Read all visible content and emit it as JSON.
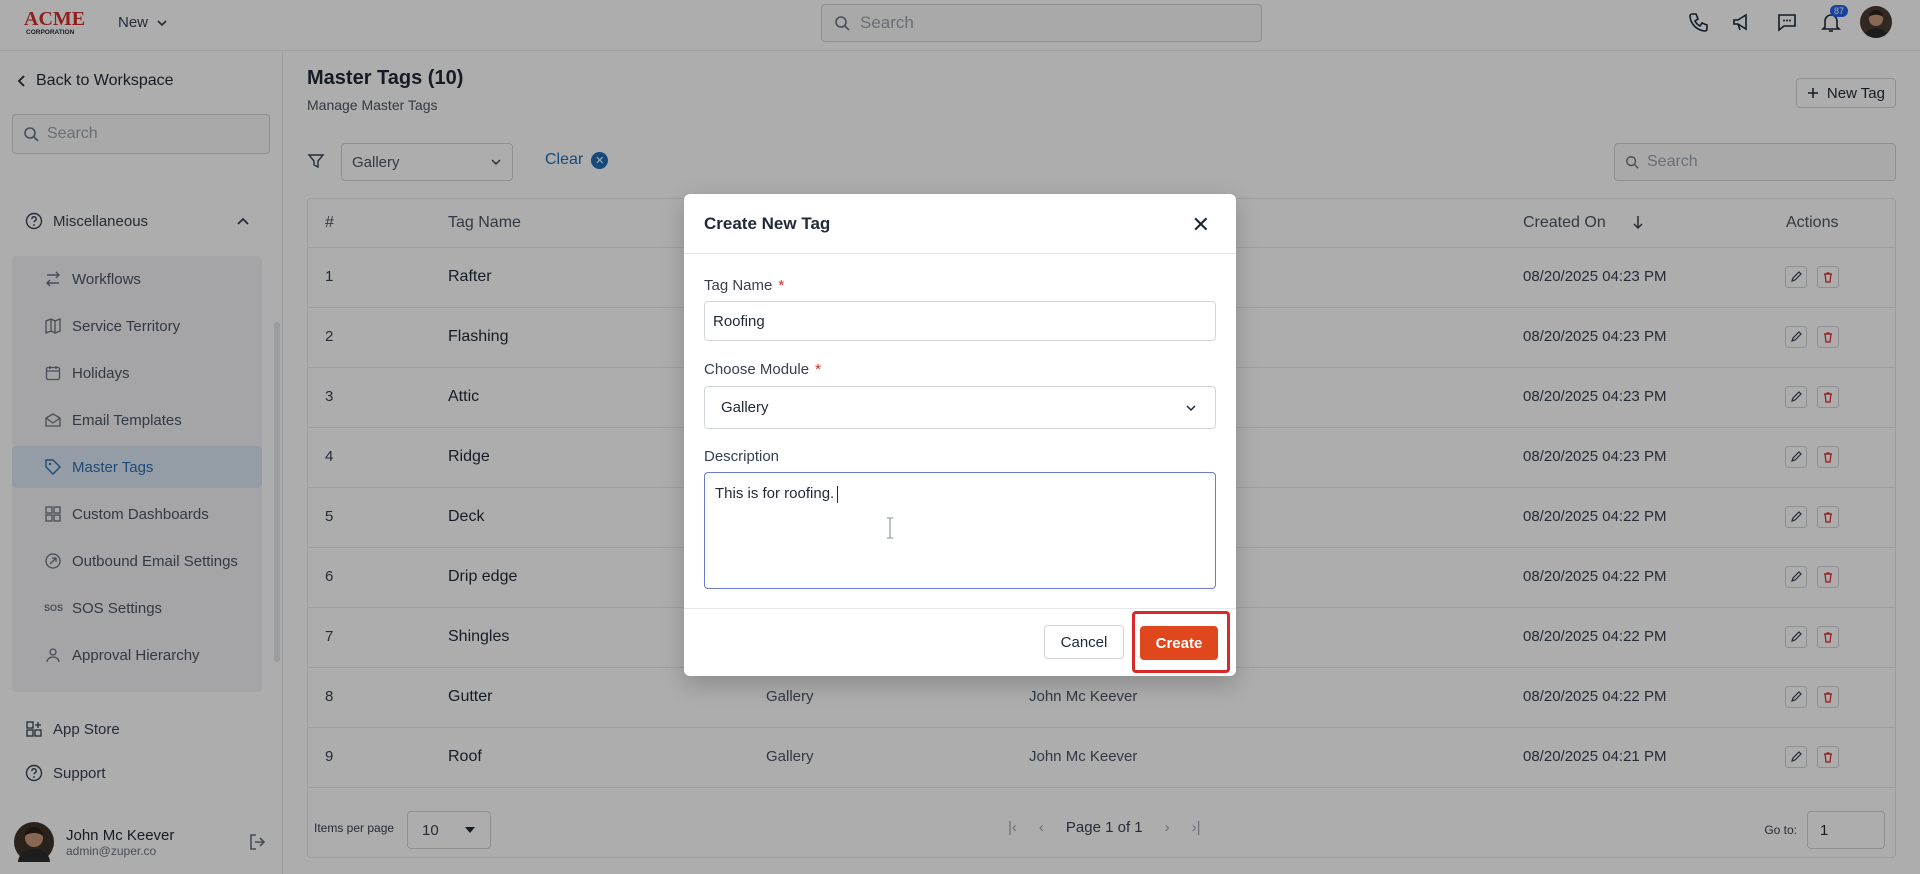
{
  "topbar": {
    "logo_text": "ACME",
    "logo_sub": "CORPORATION",
    "new_label": "New",
    "search_placeholder": "Search",
    "notification_count": "87",
    "icons": [
      "phone-icon",
      "megaphone-icon",
      "chat-icon",
      "bell-icon",
      "user-avatar"
    ]
  },
  "sidebar": {
    "back_label": "Back to Workspace",
    "search_placeholder": "Search",
    "section_label": "Miscellaneous",
    "items": [
      {
        "label": "Workflows",
        "icon": "workflow-icon"
      },
      {
        "label": "Service Territory",
        "icon": "map-icon"
      },
      {
        "label": "Holidays",
        "icon": "calendar-icon"
      },
      {
        "label": "Email Templates",
        "icon": "mail-icon"
      },
      {
        "label": "Master Tags",
        "icon": "tag-icon",
        "active": true
      },
      {
        "label": "Custom Dashboards",
        "icon": "dashboard-icon"
      },
      {
        "label": "Outbound Email Settings",
        "icon": "outbound-icon"
      },
      {
        "label": "SOS Settings",
        "icon": "sos-icon"
      },
      {
        "label": "Approval Hierarchy",
        "icon": "hierarchy-icon"
      }
    ],
    "app_store_label": "App Store",
    "support_label": "Support",
    "user": {
      "name": "John Mc Keever",
      "email": "admin@zuper.co"
    }
  },
  "main": {
    "title": "Master Tags (10)",
    "subtitle": "Manage Master Tags",
    "new_tag_label": "New Tag",
    "filter_value": "Gallery",
    "clear_label": "Clear",
    "search_placeholder": "Search",
    "columns": [
      "#",
      "Tag Name",
      "Created On",
      "Actions"
    ],
    "rows": [
      {
        "num": "1",
        "name": "Rafter",
        "module": "",
        "by": "",
        "date": "08/20/2025 04:23 PM"
      },
      {
        "num": "2",
        "name": "Flashing",
        "module": "",
        "by": "",
        "date": "08/20/2025 04:23 PM"
      },
      {
        "num": "3",
        "name": "Attic",
        "module": "",
        "by": "",
        "date": "08/20/2025 04:23 PM"
      },
      {
        "num": "4",
        "name": "Ridge",
        "module": "",
        "by": "",
        "date": "08/20/2025 04:23 PM"
      },
      {
        "num": "5",
        "name": "Deck",
        "module": "",
        "by": "",
        "date": "08/20/2025 04:22 PM"
      },
      {
        "num": "6",
        "name": "Drip edge",
        "module": "",
        "by": "",
        "date": "08/20/2025 04:22 PM"
      },
      {
        "num": "7",
        "name": "Shingles",
        "module": "",
        "by": "",
        "date": "08/20/2025 04:22 PM"
      },
      {
        "num": "8",
        "name": "Gutter",
        "module": "Gallery",
        "by": "John Mc Keever",
        "date": "08/20/2025 04:22 PM"
      },
      {
        "num": "9",
        "name": "Roof",
        "module": "Gallery",
        "by": "John Mc Keever",
        "date": "08/20/2025 04:21 PM"
      }
    ],
    "footer": {
      "items_per_page_label": "Items per page",
      "items_per_page": "10",
      "page_label": "Page 1 of 1",
      "goto_label": "Go to:",
      "goto_value": "1"
    }
  },
  "modal": {
    "title": "Create New Tag",
    "tag_name_label": "Tag Name",
    "tag_name_value": "Roofing",
    "module_label": "Choose Module",
    "module_value": "Gallery",
    "description_label": "Description",
    "description_value": "This is for roofing.",
    "required_mark": "*",
    "cancel_label": "Cancel",
    "create_label": "Create",
    "accent_color": "#e0471d",
    "highlight_color": "#d92a2a"
  }
}
